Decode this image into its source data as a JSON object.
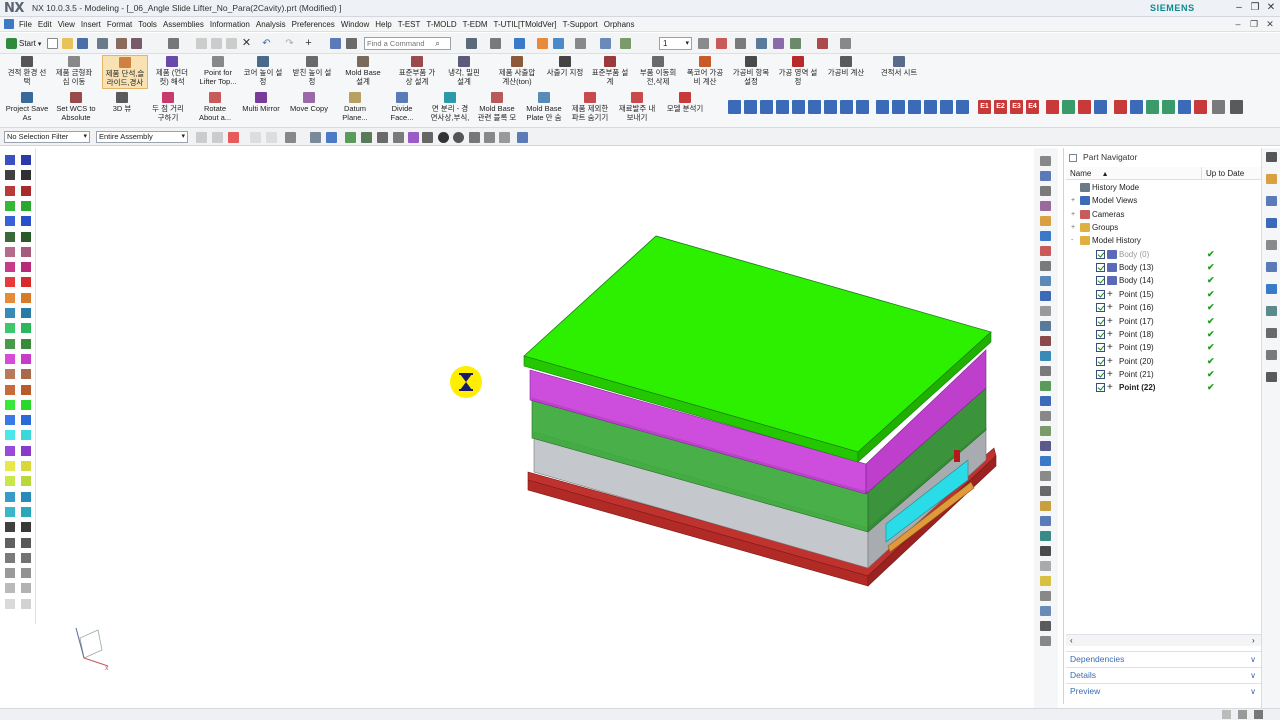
{
  "app": {
    "logo": "NX",
    "window_title": "NX 10.0.3.5 - Modeling - [_06_Angle Slide Lifter_No_Para(2Cavity).prt  (Modified) ]",
    "brand": "SIEMENS"
  },
  "menu": [
    "File",
    "Edit",
    "View",
    "Insert",
    "Format",
    "Tools",
    "Assemblies",
    "Information",
    "Analysis",
    "Preferences",
    "Window",
    "Help",
    "T-EST",
    "T-MOLD",
    "T-EDM",
    "T-UTIL[TMoldVer]",
    "T-Support",
    "Orphans"
  ],
  "toolbar": {
    "start_label": "Start",
    "find_placeholder": "Find a Command",
    "layer_value": "1"
  },
  "ribbon1": [
    {
      "label": "견적 환경 선\n택"
    },
    {
      "label": "제품 금형좌\n심 이동"
    },
    {
      "label": "제품 단석,슬\n라이드,경사"
    },
    {
      "label": "제품 (언더\n컷) 해석"
    },
    {
      "label": "Point for\nLifter Top..."
    },
    {
      "label": "코어 높이 설\n정"
    },
    {
      "label": "받친 높이 설\n정"
    },
    {
      "label": "Mold Base\n설계"
    },
    {
      "label": "표준부품 가\n상 설계"
    },
    {
      "label": "냉각, 밀핀\n설계"
    },
    {
      "label": "제품 사출압\n계산(ton)"
    },
    {
      "label": "사출기 지정"
    },
    {
      "label": "표준부품 설\n계"
    },
    {
      "label": "부품 이동회\n전,삭제"
    },
    {
      "label": "폭코어 가공\n비 계산"
    },
    {
      "label": "가공비 항목\n설정"
    },
    {
      "label": "가공 영역 설\n정"
    },
    {
      "label": "가공비 계산"
    },
    {
      "label": "견적서 시트"
    }
  ],
  "ribbon2": [
    {
      "label": "Project Save\nAs"
    },
    {
      "label": "Set WCS to\nAbsolute"
    },
    {
      "label": "3D 뷰"
    },
    {
      "label": "두 점 거리\n구하기"
    },
    {
      "label": "Rotate\nAbout a..."
    },
    {
      "label": "Multi Mirror"
    },
    {
      "label": "Move Copy"
    },
    {
      "label": "Datum\nPlane..."
    },
    {
      "label": "Divide\nFace..."
    },
    {
      "label": "면 분리 - 경\n면사상,부식,"
    },
    {
      "label": "Mold Base\n관련 블록 모"
    },
    {
      "label": "Mold Base\nPlate 만 숨"
    },
    {
      "label": "제품 제외한\n파트 숨기기"
    },
    {
      "label": "재료발주 내\n보내기"
    },
    {
      "label": "모델 분석기"
    }
  ],
  "ribbon2_letters": [
    "E1",
    "E2",
    "E3",
    "E4"
  ],
  "filter": {
    "selection_filter": "No Selection Filter",
    "assembly_scope": "Entire Assembly"
  },
  "colors": {
    "accent": "#3a6db3",
    "plate_top": "#2cf000",
    "plate_purple": "#c83ad8",
    "plate_green_dark": "#2f9a2f",
    "plate_gray": "#c0c4c8",
    "plate_red": "#c0322e",
    "cavity_cyan": "#2adce8",
    "check_green": "#20a020"
  },
  "navigator": {
    "title": "Part Navigator",
    "col_name": "Name",
    "col_uptodate": "Up to Date",
    "rows": [
      {
        "label": "History Mode",
        "icon": "history-icon",
        "level": 0,
        "expander": "",
        "check": false,
        "tick": false
      },
      {
        "label": "Model Views",
        "icon": "model-views-icon",
        "level": 0,
        "expander": "+",
        "check": false,
        "tick": false
      },
      {
        "label": "Cameras",
        "icon": "camera-icon",
        "level": 0,
        "expander": "+",
        "check": false,
        "tick": false
      },
      {
        "label": "Groups",
        "icon": "folder-icon",
        "level": 0,
        "expander": "+",
        "check": false,
        "tick": false
      },
      {
        "label": "Model History",
        "icon": "folder-icon",
        "level": 0,
        "expander": "-",
        "check": false,
        "tick": false
      },
      {
        "label": "Body (0)",
        "icon": "body-icon",
        "level": 1,
        "check": true,
        "tick": true,
        "dim": true
      },
      {
        "label": "Body (13)",
        "icon": "body-icon",
        "level": 1,
        "check": true,
        "tick": true
      },
      {
        "label": "Body (14)",
        "icon": "body-icon",
        "level": 1,
        "check": true,
        "tick": true
      },
      {
        "label": "Point (15)",
        "icon": "point-icon",
        "level": 1,
        "check": true,
        "tick": true
      },
      {
        "label": "Point (16)",
        "icon": "point-icon",
        "level": 1,
        "check": true,
        "tick": true
      },
      {
        "label": "Point (17)",
        "icon": "point-icon",
        "level": 1,
        "check": true,
        "tick": true
      },
      {
        "label": "Point (18)",
        "icon": "point-icon",
        "level": 1,
        "check": true,
        "tick": true
      },
      {
        "label": "Point (19)",
        "icon": "point-icon",
        "level": 1,
        "check": true,
        "tick": true
      },
      {
        "label": "Point (20)",
        "icon": "point-icon",
        "level": 1,
        "check": true,
        "tick": true
      },
      {
        "label": "Point (21)",
        "icon": "point-icon",
        "level": 1,
        "check": true,
        "tick": true
      },
      {
        "label": "Point (22)",
        "icon": "point-icon",
        "level": 1,
        "check": true,
        "tick": true,
        "bold": true
      }
    ],
    "tick_glyph": "✔",
    "panels": [
      "Dependencies",
      "Details",
      "Preview"
    ]
  },
  "palette_colors": [
    [
      "#3a4fc2",
      "#2a3aa8"
    ],
    [
      "#404040",
      "#303030"
    ],
    [
      "#b83a3a",
      "#a82a2a"
    ],
    [
      "#35b83a",
      "#2aa830"
    ],
    [
      "#3a62d8",
      "#2a50c8"
    ],
    [
      "#3a6a3a",
      "#2a5a2a"
    ],
    [
      "#b86a8a",
      "#a85a7a"
    ],
    [
      "#c83a8a",
      "#b82a7a"
    ],
    [
      "#e83a3a",
      "#d82a2a"
    ],
    [
      "#e88a3a",
      "#d87a2a"
    ],
    [
      "#3a8ab8",
      "#2a7aa8"
    ],
    [
      "#3ac86a",
      "#2ab85a"
    ],
    [
      "#4a9a4a",
      "#3a8a3a"
    ],
    [
      "#d84ad8",
      "#c83ac8"
    ],
    [
      "#b87a5a",
      "#a86a4a"
    ],
    [
      "#c86a3a",
      "#b85a2a"
    ],
    [
      "#3ae83a",
      "#2ad82a"
    ],
    [
      "#3a7ae8",
      "#2a6ad8"
    ],
    [
      "#4ae8e8",
      "#3ad8d8"
    ],
    [
      "#9a4ad8",
      "#8a3ac8"
    ],
    [
      "#e8e84a",
      "#d8d83a"
    ],
    [
      "#c8e84a",
      "#b8d83a"
    ],
    [
      "#3a9ac8",
      "#2a8ab8"
    ],
    [
      "#3ab8c8",
      "#2aa8b8"
    ],
    [
      "#404040",
      "#383838"
    ],
    [
      "#606060",
      "#585858"
    ],
    [
      "#7a7a7a",
      "#727272"
    ],
    [
      "#9a9a9a",
      "#929292"
    ],
    [
      "#bababa",
      "#b2b2b2"
    ],
    [
      "#dadada",
      "#d2d2d2"
    ]
  ]
}
